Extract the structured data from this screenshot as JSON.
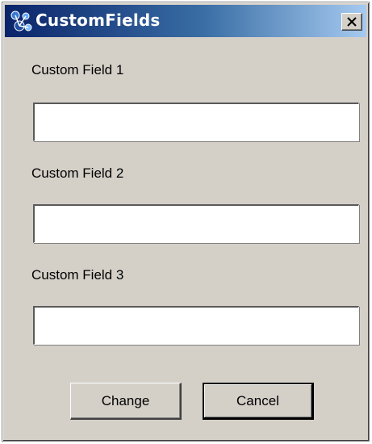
{
  "window": {
    "title": "CustomFields",
    "icon": "app-icon",
    "close_icon": "close-icon"
  },
  "fields": [
    {
      "label": "Custom Field 1",
      "value": "",
      "placeholder": ""
    },
    {
      "label": "Custom Field 2",
      "value": "",
      "placeholder": ""
    },
    {
      "label": "Custom Field 3",
      "value": "",
      "placeholder": ""
    }
  ],
  "buttons": {
    "change_label": "Change",
    "cancel_label": "Cancel"
  },
  "colors": {
    "title_bar_start": "#0a246a",
    "title_bar_end": "#a6caf0",
    "window_face": "#d4d0c8"
  }
}
